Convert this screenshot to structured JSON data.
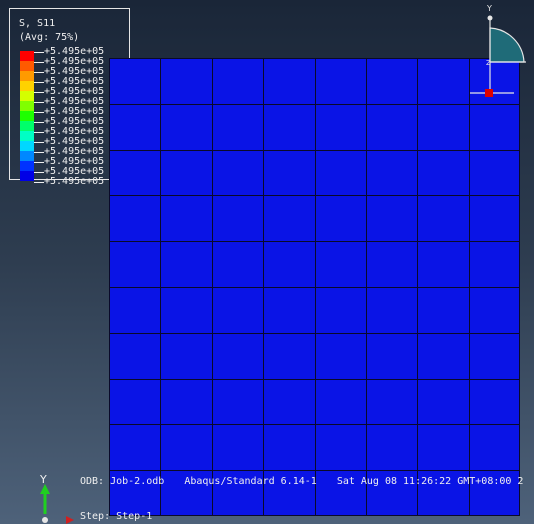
{
  "legend": {
    "title": "S, S11",
    "avg": "(Avg: 75%)",
    "entries": [
      {
        "color": "#ff0000",
        "label": "+5.495e+05"
      },
      {
        "color": "#ff5a00",
        "label": "+5.495e+05"
      },
      {
        "color": "#ff9a00",
        "label": "+5.495e+05"
      },
      {
        "color": "#ffd200",
        "label": "+5.495e+05"
      },
      {
        "color": "#d4ff00",
        "label": "+5.495e+05"
      },
      {
        "color": "#80ff00",
        "label": "+5.495e+05"
      },
      {
        "color": "#1eff00",
        "label": "+5.495e+05"
      },
      {
        "color": "#00ff6a",
        "label": "+5.495e+05"
      },
      {
        "color": "#00ffc4",
        "label": "+5.495e+05"
      },
      {
        "color": "#00d8ff",
        "label": "+5.495e+05"
      },
      {
        "color": "#0088ff",
        "label": "+5.495e+05"
      },
      {
        "color": "#0032ff",
        "label": "+5.495e+05"
      },
      {
        "color": "#0000e6",
        "label": "+5.495e+05"
      }
    ]
  },
  "mesh": {
    "columns": 8,
    "rows": 10,
    "fill_color": "#0a14e6"
  },
  "footer": {
    "odb": "ODB: Job-2.odb",
    "solver": "Abaqus/Standard 6.14-1",
    "date": "Sat Aug 08 11:26:22 GMT+08:00 2"
  },
  "step": "Step: Step-1",
  "triad": {
    "y": "Y",
    "z": "Z"
  },
  "axis_label": "Y"
}
